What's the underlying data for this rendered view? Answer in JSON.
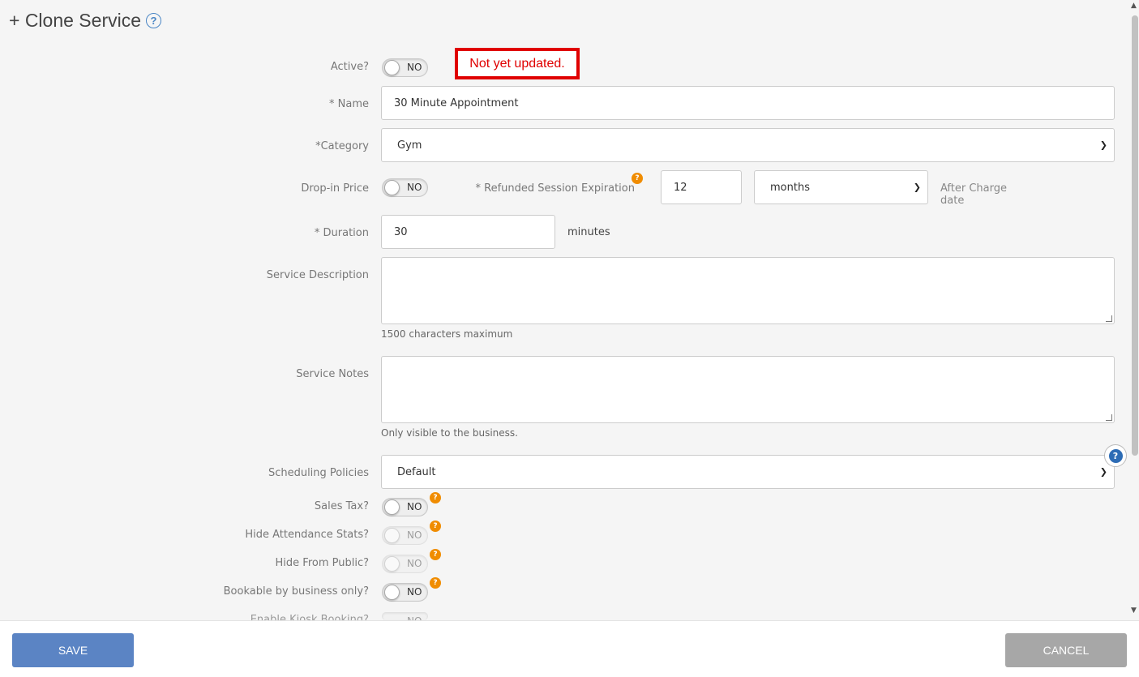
{
  "header": {
    "title": "+ Clone Service",
    "help_icon": "?"
  },
  "notice": "Not yet updated.",
  "form": {
    "active_label": "Active?",
    "active_value": "NO",
    "name_label": "* Name",
    "name_value": "30 Minute Appointment",
    "category_label": "*Category",
    "category_value": "Gym",
    "dropin_label": "Drop-in Price",
    "dropin_value": "NO",
    "refund_label": "* Refunded Session Expiration",
    "refund_value": "12",
    "refund_unit": "months",
    "refund_suffix_1": "After Charge",
    "refund_suffix_2": "date",
    "duration_label": "* Duration",
    "duration_value": "30",
    "duration_unit": "minutes",
    "description_label": "Service Description",
    "description_hint": "1500 characters maximum",
    "notes_label": "Service Notes",
    "notes_hint": "Only visible to the business.",
    "policies_label": "Scheduling Policies",
    "policies_value": "Default",
    "sales_tax_label": "Sales Tax?",
    "sales_tax_value": "NO",
    "hide_stats_label": "Hide Attendance Stats?",
    "hide_stats_value": "NO",
    "hide_public_label": "Hide From Public?",
    "hide_public_value": "NO",
    "bookable_label": "Bookable by business only?",
    "bookable_value": "NO",
    "kiosk_label": "Enable Kiosk Booking?",
    "kiosk_value": "NO"
  },
  "footer": {
    "save": "SAVE",
    "cancel": "CANCEL"
  },
  "colors": {
    "save": "#5b84c4",
    "cancel": "#a7a7a7",
    "notice": "#e00000",
    "badge": "#f08c00"
  }
}
